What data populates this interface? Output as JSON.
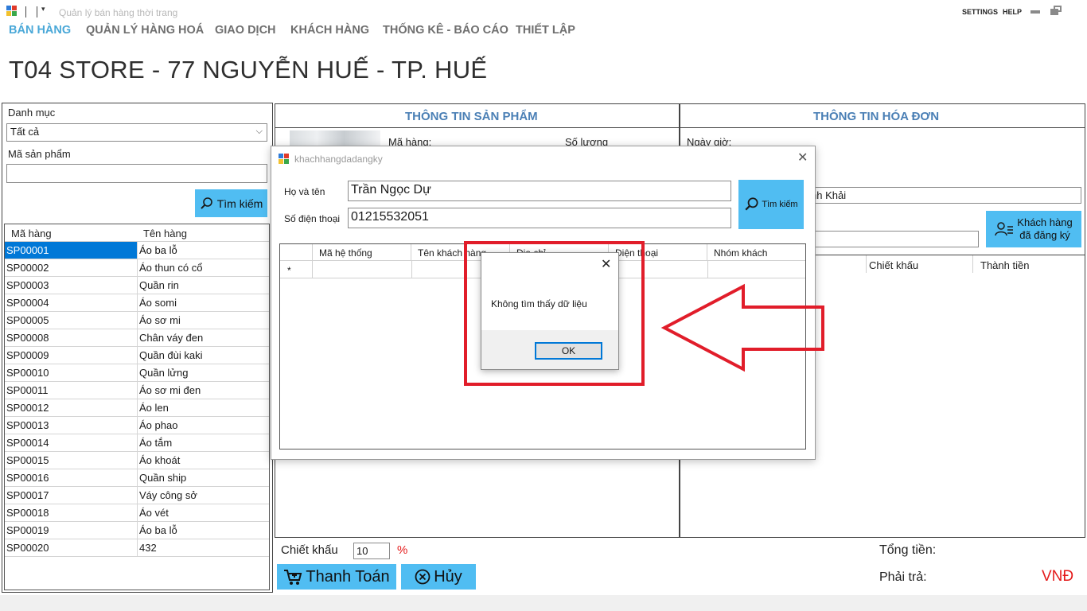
{
  "window": {
    "title": "Quản lý bán hàng thời trang",
    "settings": "SETTINGS",
    "help": "HELP",
    "minimize_icon": "minimize-icon",
    "restore_icon": "restore-icon"
  },
  "menu": [
    "BÁN HÀNG",
    "QUẢN LÝ HÀNG HOÁ",
    "GIAO DỊCH",
    "KHÁCH HÀNG",
    "THỐNG KÊ - BÁO CÁO",
    "THIẾT LẬP"
  ],
  "store_title": "T04 STORE - 77 NGUYỄN HUẾ - TP. HUẾ",
  "left": {
    "category_label": "Danh mục",
    "category_value": "Tất cả",
    "product_code_label": "Mã sản phẩm",
    "product_code_value": "",
    "search_button": "Tìm kiếm",
    "columns": [
      "Mã hàng",
      "Tên hàng"
    ],
    "rows": [
      [
        "SP00001",
        "Áo ba lỗ"
      ],
      [
        "SP00002",
        "Áo thun có cổ"
      ],
      [
        "SP00003",
        "Quần rin"
      ],
      [
        "SP00004",
        "Áo somi"
      ],
      [
        "SP00005",
        "Áo sơ mi"
      ],
      [
        "SP00008",
        "Chân váy đen"
      ],
      [
        "SP00009",
        "Quần đùi kaki"
      ],
      [
        "SP00010",
        "Quần lửng"
      ],
      [
        "SP00011",
        "Áo sơ mi đen"
      ],
      [
        "SP00012",
        "Áo len"
      ],
      [
        "SP00013",
        "Áo phao"
      ],
      [
        "SP00014",
        "Áo tắm"
      ],
      [
        "SP00015",
        "Áo khoát"
      ],
      [
        "SP00016",
        "Quần ship"
      ],
      [
        "SP00017",
        "Váy công sở"
      ],
      [
        "SP00018",
        "Áo vét"
      ],
      [
        "SP00019",
        "Áo ba lỗ"
      ],
      [
        "SP00020",
        "432"
      ]
    ]
  },
  "product_info": {
    "title": "THÔNG TIN SẢN PHẨM",
    "code_label": "Mã hàng:",
    "quantity_label": "Số lượng"
  },
  "invoice": {
    "title": "THÔNG TIN HÓA ĐƠN",
    "datetime_label": "Ngày giờ:",
    "customer_partial": "nh Khải",
    "registered_button_line1": "Khách hàng",
    "registered_button_line2": "đã đăng ký",
    "columns": [
      "Chiết khấu",
      "Thành tiền"
    ]
  },
  "footer": {
    "discount_label": "Chiết khấu",
    "discount_value": "10",
    "percent": "%",
    "pay_button": "Thanh Toán",
    "cancel_button": "Hủy",
    "total_label": "Tổng tiền:",
    "payable_label": "Phải trả:",
    "currency": "VNĐ"
  },
  "dialog": {
    "title": "khachhangdadangky",
    "name_label": "Họ và tên",
    "name_value": "Trần Ngọc Dự",
    "phone_label": "Số điện thoại",
    "phone_value": "01215532051",
    "search_button": "Tìm kiếm",
    "columns": [
      "Mã hệ thống",
      "Tên khách hàng",
      "Địa chỉ",
      "Điện thoại",
      "Nhóm khách"
    ],
    "new_row_marker": "*"
  },
  "message_box": {
    "text": "Không tìm thấy dữ liệu",
    "ok": "OK"
  },
  "colors": {
    "accent": "#50bdf2",
    "active_menu": "#4aa8d8",
    "selection": "#0078d7",
    "annotation_red": "#e11d2a"
  }
}
